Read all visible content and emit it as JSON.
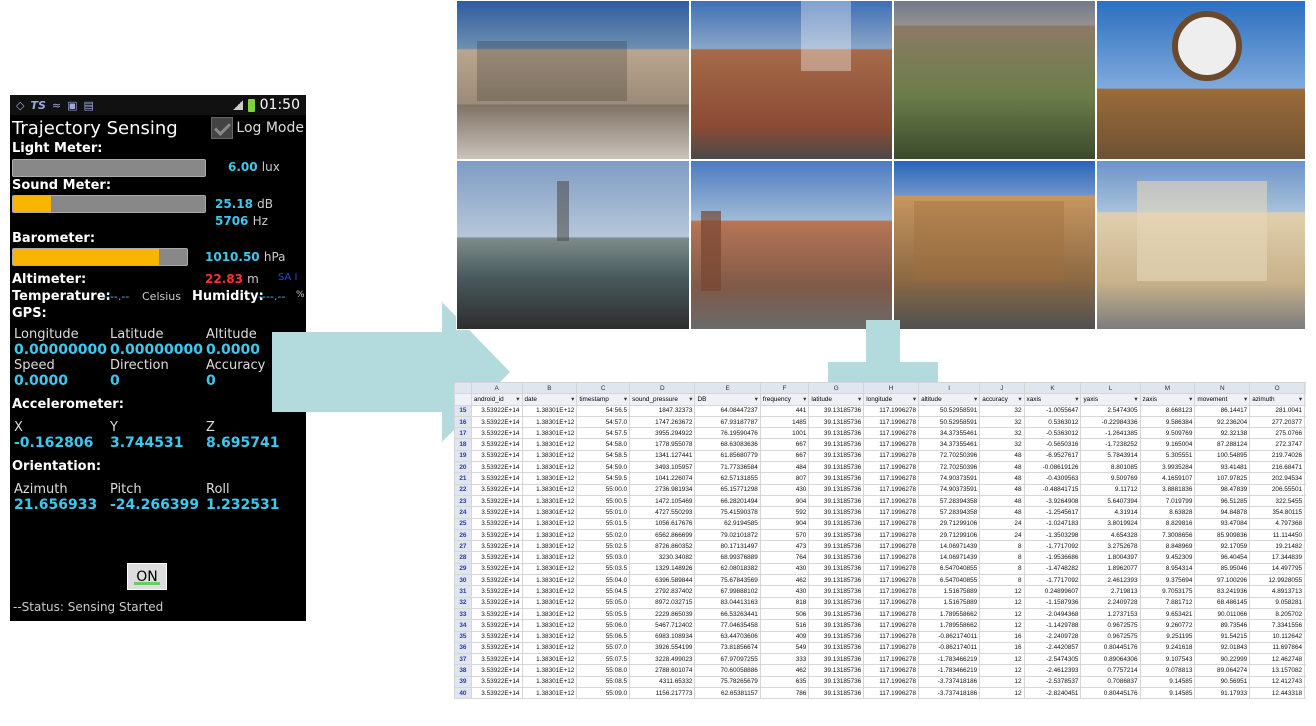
{
  "phone": {
    "status_bar": {
      "left_icons": [
        "sync-icon",
        "ts-icon",
        "wifi-icon",
        "cast-icon",
        "file-icon"
      ],
      "time": "01:50"
    },
    "title": "Trajectory Sensing",
    "log_mode_label": "Log Mode",
    "light_meter": {
      "label": "Light Meter:",
      "value": "6.00",
      "unit": "lux",
      "level": 0
    },
    "sound_meter": {
      "label": "Sound Meter:",
      "db_value": "25.18",
      "db_unit": "dB",
      "hz_value": "5706",
      "hz_unit": "Hz",
      "level": 0.2
    },
    "barometer": {
      "label": "Barometer:",
      "value": "1010.50",
      "unit": "hPa",
      "level": 0.84
    },
    "altimeter": {
      "label": "Altimeter:",
      "value": "22.83",
      "unit": "m",
      "extra": "SA I"
    },
    "temperature": {
      "label": "Temperature:",
      "value": "----.--",
      "unit": "Celsius"
    },
    "humidity": {
      "label": "Humidity:",
      "value": "----.--",
      "unit": "%"
    },
    "gps": {
      "label": "GPS:",
      "row1_headers": [
        "Longitude",
        "Latitude",
        "Altitude"
      ],
      "row1_values": [
        "0.00000000",
        "0.00000000",
        "0.0000"
      ],
      "row2_headers": [
        "Speed",
        "Direction",
        "Accuracy"
      ],
      "row2_values": [
        "0.0000",
        "0",
        "0"
      ]
    },
    "accelerometer": {
      "label": "Accelerometer:",
      "headers": [
        "X",
        "Y",
        "Z"
      ],
      "values": [
        "-0.162806",
        "3.744531",
        "8.695741"
      ]
    },
    "orientation": {
      "label": "Orientation:",
      "headers": [
        "Azimuth",
        "Pitch",
        "Roll"
      ],
      "values": [
        "21.656933",
        "-24.266399",
        "1.232531"
      ]
    },
    "on_button": "ON",
    "status": "--Status: Sensing Started"
  },
  "colors": {
    "accent": "#3ec8ee",
    "meter_fill": "#f7b500",
    "arrow": "#b3dadc",
    "altitude_red": "#ff3030"
  },
  "sheet": {
    "columns": [
      "",
      "A",
      "B",
      "C",
      "D",
      "E",
      "F",
      "G",
      "H",
      "I",
      "J",
      "K",
      "L",
      "M",
      "N",
      "O",
      "P"
    ],
    "headers": [
      "android_id",
      "date",
      "timestamp",
      "sound_pressure",
      "DB",
      "frequency",
      "latitude",
      "longitude",
      "altitude",
      "accuracy",
      "xaxis",
      "yaxis",
      "zaxis",
      "movement",
      "azimuth",
      "pitch"
    ],
    "rows": [
      [
        "15",
        "3.53922E+14",
        "1.38301E+12",
        "54:56.5",
        "1847.32373",
        "64.08447237",
        "441",
        "39.13185736",
        "117.1996278",
        "50.52958591",
        "32",
        "-1.0055647",
        "2.5474305",
        "8.668123",
        "86.14417",
        "281.0041",
        "-15.2268"
      ],
      [
        "16",
        "3.53922E+14",
        "1.38301E+12",
        "54:57.0",
        "1747.263672",
        "67.93187787",
        "1485",
        "39.13185736",
        "117.1996278",
        "50.52958591",
        "32",
        "0.5363012",
        "-0.22984336",
        "9.586384",
        "92.236204",
        "277.20377",
        "-1.87012"
      ],
      [
        "17",
        "3.53922E+14",
        "1.38301E+12",
        "54:57.5",
        "3955.294922",
        "76.19590476",
        "1001",
        "39.13185736",
        "117.1996278",
        "34.37355461",
        "32",
        "-0.5363012",
        "-1.2641385",
        "9.509769",
        "92.32138",
        "275.0766",
        "7.11874"
      ],
      [
        "18",
        "3.53922E+14",
        "1.38301E+12",
        "54:58.0",
        "1778.955078",
        "68.63083636",
        "667",
        "39.13185736",
        "117.1996278",
        "34.37355461",
        "32",
        "-0.5650316",
        "-1.7238252",
        "9.165004",
        "87.288124",
        "272.3747",
        "11.424"
      ],
      [
        "19",
        "3.53922E+14",
        "1.38301E+12",
        "54:58.5",
        "1341.127441",
        "61.85680779",
        "667",
        "39.13185736",
        "117.1996278",
        "72.70250396",
        "48",
        "-6.9527617",
        "5.7843914",
        "5.305551",
        "100.54895",
        "219.74026",
        "-27.9545"
      ],
      [
        "20",
        "3.53922E+14",
        "1.38301E+12",
        "54:59.0",
        "3493.105957",
        "71.77336584",
        "484",
        "39.13185736",
        "117.1996278",
        "72.70250396",
        "48",
        "-0.08619126",
        "8.801085",
        "3.9935284",
        "93.41481",
        "216.68471",
        "-51.5806"
      ],
      [
        "21",
        "3.53922E+14",
        "1.38301E+12",
        "54:59.5",
        "1041.226074",
        "62.57131855",
        "807",
        "39.13185736",
        "117.1996278",
        "74.90373591",
        "48",
        "-0.4309563",
        "9.509769",
        "4.1659107",
        "107.97825",
        "202.94534",
        "-52.897"
      ],
      [
        "22",
        "3.53922E+14",
        "1.38301E+12",
        "55:00.0",
        "2736.981934",
        "65.15771298",
        "430",
        "39.13185736",
        "117.1996278",
        "74.90373591",
        "48",
        "-0.48841715",
        "9.11712",
        "3.8881836",
        "98.47839",
        "206.55501",
        "-57.203"
      ],
      [
        "23",
        "3.53922E+14",
        "1.38301E+12",
        "55:00.5",
        "1472.105469",
        "66.28201494",
        "904",
        "39.13185736",
        "117.1996278",
        "57.28394358",
        "48",
        "-3.9264908",
        "5.6407394",
        "7.019799",
        "96.51285",
        "322.5455",
        "-34.0043"
      ],
      [
        "24",
        "3.53922E+14",
        "1.38301E+12",
        "55:01.0",
        "4727.550293",
        "75.41590378",
        "592",
        "39.13185736",
        "117.1996278",
        "57.28394358",
        "48",
        "-1.2545617",
        "4.31914",
        "8.63828",
        "94.84878",
        "354.80115",
        "-35.9953"
      ],
      [
        "25",
        "3.53922E+14",
        "1.38301E+12",
        "55:01.5",
        "1056.617676",
        "62.9194585",
        "904",
        "39.13185736",
        "117.1996278",
        "29.71299106",
        "24",
        "-1.0247183",
        "3.8019924",
        "8.829816",
        "93.47084",
        "4.797368",
        "-35.5"
      ],
      [
        "26",
        "3.53922E+14",
        "1.38301E+12",
        "55:02.0",
        "6562.866699",
        "79.02101872",
        "570",
        "39.13185736",
        "117.1996278",
        "29.71299106",
        "24",
        "-1.3503298",
        "4.654328",
        "7.3008656",
        "85.909836",
        "11.114450",
        "-39.3010"
      ],
      [
        "27",
        "3.53922E+14",
        "1.38301E+12",
        "55:02.5",
        "8726.860352",
        "80.17131497",
        "473",
        "39.13185736",
        "117.1996278",
        "14.06971439",
        "8",
        "-1.7717092",
        "3.2752678",
        "8.848969",
        "92.17059",
        "19.21482",
        "-30.9723"
      ],
      [
        "28",
        "3.53922E+14",
        "1.38301E+12",
        "55:03.0",
        "3230.34082",
        "68.99376889",
        "764",
        "39.13185736",
        "117.1996278",
        "14.06971439",
        "8",
        "-1.9536686",
        "1.8004397",
        "9.452309",
        "96.40454",
        "17.344839",
        "-21.6432"
      ],
      [
        "29",
        "3.53922E+14",
        "1.38301E+12",
        "55:03.5",
        "1329.148926",
        "62.08018382",
        "430",
        "39.13185736",
        "117.1996278",
        "6.547040855",
        "8",
        "-1.4748282",
        "1.8962077",
        "8.954314",
        "85.95046",
        "14.497795",
        "-20.4906"
      ],
      [
        "30",
        "3.53922E+14",
        "1.38301E+12",
        "55:04.0",
        "6396.589844",
        "75.67843569",
        "462",
        "39.13185736",
        "117.1996278",
        "6.547040855",
        "8",
        "-1.7717092",
        "2.4612393",
        "9.375694",
        "97.100296",
        "12.9928055",
        "-23.9937"
      ],
      [
        "31",
        "3.53922E+14",
        "1.38301E+12",
        "55:04.5",
        "2792.837402",
        "67.99888102",
        "430",
        "39.13185736",
        "117.1996278",
        "1.51675889",
        "12",
        "0.24899607",
        "2.719813",
        "9.7053175",
        "83.241936",
        "4.8913713",
        "-26.026"
      ],
      [
        "32",
        "3.53922E+14",
        "1.38301E+12",
        "55:05.0",
        "8972.032715",
        "83.04413163",
        "818",
        "39.13185736",
        "117.1996278",
        "1.51675889",
        "12",
        "-1.1587936",
        "2.2409728",
        "7.881712",
        "68.486145",
        "9.058281",
        "-24.367"
      ],
      [
        "33",
        "3.53922E+14",
        "1.38301E+12",
        "55:05.5",
        "2229.865039",
        "66.53263441",
        "506",
        "39.13185736",
        "117.1996278",
        "1.789558662",
        "12",
        "-2.0494368",
        "1.2737153",
        "9.653421",
        "90.011066",
        "8.205702",
        "-17.1188"
      ],
      [
        "34",
        "3.53922E+14",
        "1.38301E+12",
        "55:06.0",
        "5467.712402",
        "77.04635458",
        "516",
        "39.13185736",
        "117.1996278",
        "1.789558662",
        "12",
        "-1.1429788",
        "0.9672575",
        "9.260772",
        "89.73546",
        "7.3341556",
        "-14.4336"
      ],
      [
        "35",
        "3.53922E+14",
        "1.38301E+12",
        "55:06.5",
        "6983.108934",
        "63.44703606",
        "409",
        "39.13185736",
        "117.1996278",
        "-0.862174011",
        "16",
        "-2.2409728",
        "0.9672575",
        "9.251195",
        "91.54215",
        "10.112642",
        "-13.7471"
      ],
      [
        "36",
        "3.53922E+14",
        "1.38301E+12",
        "55:07.0",
        "3926.554199",
        "73.81856674",
        "549",
        "39.13185736",
        "117.1996278",
        "-0.862174011",
        "16",
        "-2.4420857",
        "0.80445176",
        "9.241618",
        "92.01843",
        "11.697864",
        "-12.3230"
      ],
      [
        "37",
        "3.53922E+14",
        "1.38301E+12",
        "55:07.5",
        "3228.499023",
        "67.97097255",
        "333",
        "39.13185736",
        "117.1996278",
        "-1.783466219",
        "12",
        "-2.5474305",
        "0.89064306",
        "9.107543",
        "90.22999",
        "12.462748",
        "-11.908"
      ],
      [
        "38",
        "3.53922E+14",
        "1.38301E+12",
        "55:08.0",
        "2788.601074",
        "70.60058886",
        "462",
        "39.13185736",
        "117.1996278",
        "-1.783466219",
        "12",
        "-2.4612393",
        "0.7757214",
        "9.078813",
        "89.064274",
        "13.157082",
        "-11.1870"
      ],
      [
        "39",
        "3.53922E+14",
        "1.38301E+12",
        "55:08.5",
        "4311.65332",
        "75.78265679",
        "635",
        "39.13185736",
        "117.1996278",
        "-3.737418186",
        "12",
        "-2.5378537",
        "0.7086837",
        "9.14585",
        "90.56951",
        "12.412743",
        "-9.8848"
      ],
      [
        "40",
        "3.53922E+14",
        "1.38301E+12",
        "55:09.0",
        "1156.217773",
        "62.65381157",
        "786",
        "39.13185736",
        "117.1996278",
        "-3.737418186",
        "12",
        "-2.8240451",
        "0.80445176",
        "9.14585",
        "91.17933",
        "12.443318",
        "-10.0748"
      ]
    ]
  }
}
